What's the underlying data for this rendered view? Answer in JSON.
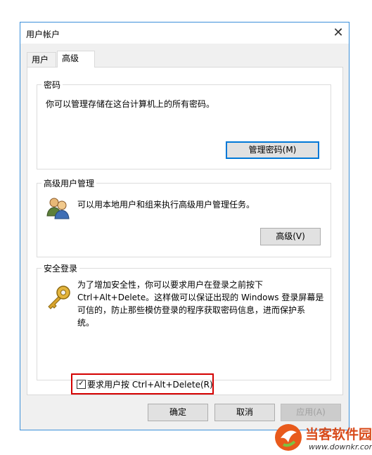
{
  "window": {
    "title": "用户帐户",
    "close_glyph": "✕"
  },
  "tabs": [
    {
      "label": "用户",
      "selected": false
    },
    {
      "label": "高级",
      "selected": true
    }
  ],
  "passwords": {
    "title": "密码",
    "text": "你可以管理存储在这台计算机上的所有密码。",
    "button_label": "管理密码(M)"
  },
  "advanced_user": {
    "title": "高级用户管理",
    "icon": "users-icon",
    "text": "可以用本地用户和组来执行高级用户管理任务。",
    "button_label": "高级(V)"
  },
  "secure_logon": {
    "title": "安全登录",
    "icon": "key-icon",
    "text_line1": "为了增加安全性，你可以要求用户在登录之前按下",
    "text_line2": "Ctrl+Alt+Delete。这样做可以保证出现的 Windows 登录屏幕是",
    "text_line3": "可信的，防止那些模仿登录的程序获取密码信息，进而保护系",
    "text_line4": "统。",
    "checkbox_label": "要求用户按 Ctrl+Alt+Delete(R)",
    "checkbox_checked": true,
    "checkbox_glyph": "✓",
    "highlight_color": "#d40000"
  },
  "footer": {
    "ok_label": "确定",
    "cancel_label": "取消",
    "apply_label": "应用(A)"
  },
  "watermark": {
    "title": "当客软件园",
    "url": "www.downkr.com"
  }
}
